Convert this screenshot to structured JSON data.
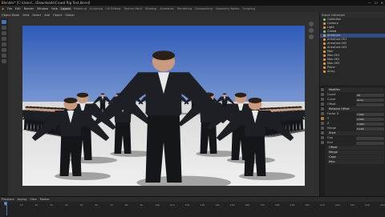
{
  "window": {
    "title": "Blender* [C:\\Users\\...\\Downloads\\Crowd Rig Test.blend]",
    "controls": [
      "—",
      "☐",
      "✕"
    ]
  },
  "menubar": {
    "items": [
      "File",
      "Edit",
      "Render",
      "Window",
      "Help"
    ],
    "workspaces": [
      "Layout",
      "Modeling",
      "Sculpting",
      "UV Editing",
      "Texture Paint",
      "Shading",
      "Animation",
      "Rendering",
      "Compositing",
      "Geometry Nodes",
      "Scripting"
    ],
    "active_workspace": "Layout"
  },
  "viewport_header": {
    "items": [
      "Object Mode",
      "View",
      "Select",
      "Add",
      "Object",
      "Global"
    ]
  },
  "outliner": {
    "header": "Scene Collection",
    "rows": [
      {
        "label": "Collection",
        "kind": "g"
      },
      {
        "label": "Camera",
        "kind": "o"
      },
      {
        "label": "Light",
        "kind": "o"
      },
      {
        "label": "Crowd",
        "kind": "g"
      },
      {
        "label": "Armature",
        "kind": "o"
      },
      {
        "label": "Armature.001",
        "kind": "o"
      },
      {
        "label": "Armature.002",
        "kind": "o"
      },
      {
        "label": "Armature.003",
        "kind": "o"
      },
      {
        "label": "Man",
        "kind": "o"
      },
      {
        "label": "Man.001",
        "kind": "o"
      },
      {
        "label": "Man.002",
        "kind": "o"
      },
      {
        "label": "Man.003",
        "kind": "o"
      },
      {
        "label": "Plane",
        "kind": "o"
      },
      {
        "label": "Array",
        "kind": "o"
      }
    ],
    "selected_index": 4
  },
  "properties": {
    "sections": [
      {
        "title": "Modifier",
        "rows": [
          {
            "label": "Count",
            "value": "28"
          },
          {
            "label": "Curve",
            "value": "Array"
          },
          {
            "label": "Offset",
            "value": ""
          }
        ]
      },
      {
        "title": "Relative Offset",
        "rows": [
          {
            "label": "Factor X",
            "value": "1.000"
          },
          {
            "label": "Y",
            "value": "0.000"
          },
          {
            "label": "Z",
            "value": "0.000"
          },
          {
            "label": "Merge",
            "value": "0.100"
          }
        ]
      },
      {
        "title": "Start",
        "rows": [
          {
            "label": "Cap",
            "value": ""
          },
          {
            "label": "End",
            "value": ""
          }
        ]
      },
      {
        "title": "Offset",
        "rows": []
      },
      {
        "title": "Merge",
        "rows": []
      },
      {
        "title": "Caps",
        "rows": []
      },
      {
        "title": "Misc",
        "rows": []
      }
    ]
  },
  "timeline": {
    "header": [
      "Playback",
      "Keying",
      "View",
      "Marker"
    ],
    "ticks": [
      "0",
      "10",
      "20",
      "30",
      "40",
      "50",
      "60",
      "70",
      "80",
      "90",
      "100",
      "110",
      "120",
      "130",
      "140",
      "150",
      "160",
      "170",
      "180",
      "190",
      "200",
      "210",
      "220",
      "230",
      "240",
      "250"
    ],
    "current_frame": "1"
  },
  "colors": {
    "accent": "#4772b3",
    "sky_top": "#2e5bb8",
    "sky_bottom": "#c9d6ea",
    "ground": "#e4e4e4"
  }
}
